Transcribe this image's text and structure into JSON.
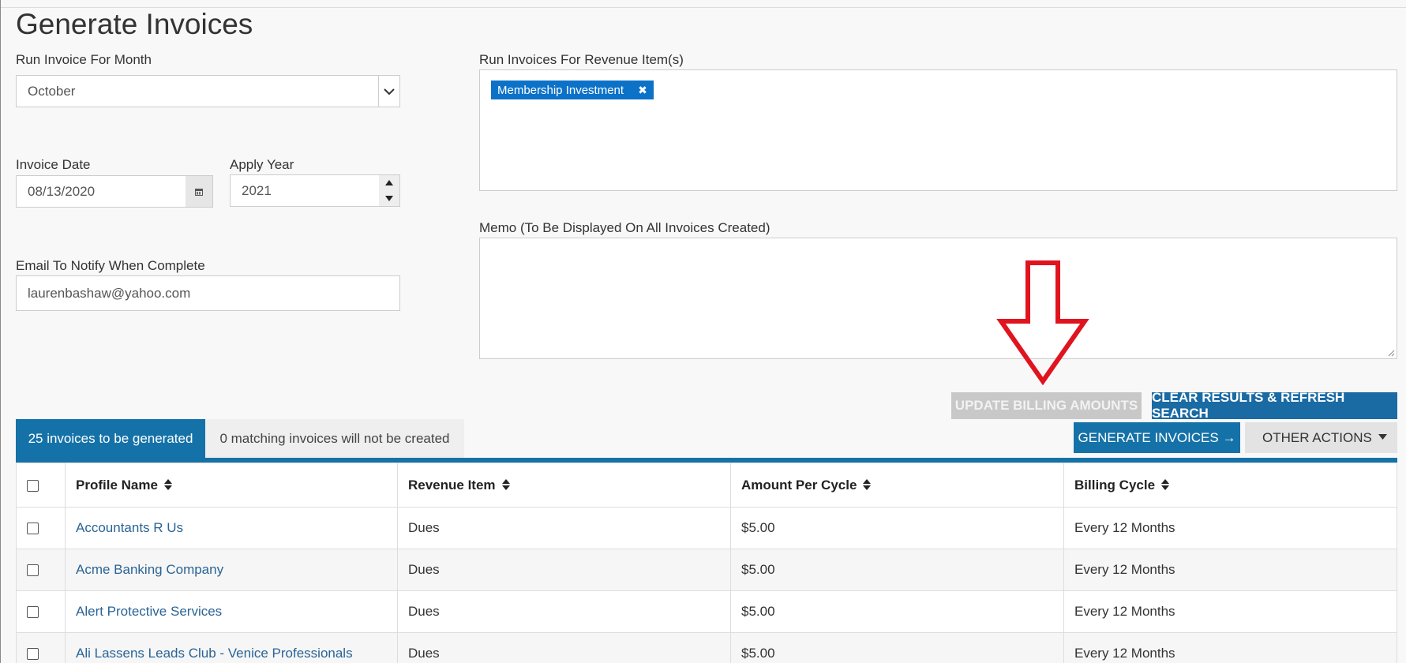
{
  "page": {
    "title": "Generate Invoices"
  },
  "form": {
    "month": {
      "label": "Run Invoice For Month",
      "value": "October"
    },
    "invoice_date": {
      "label": "Invoice Date",
      "value": "08/13/2020"
    },
    "apply_year": {
      "label": "Apply Year",
      "value": "2021"
    },
    "email": {
      "label": "Email To Notify When Complete",
      "value": "laurenbashaw@yahoo.com"
    },
    "revenue_items": {
      "label": "Run Invoices For Revenue Item(s)",
      "chips": [
        "Membership Investment"
      ],
      "chip_remove": "✖"
    },
    "memo": {
      "label": "Memo (To Be Displayed On All Invoices Created)",
      "value": ""
    }
  },
  "actions": {
    "update_billing": "UPDATE BILLING AMOUNTS",
    "clear_refresh": "CLEAR RESULTS & REFRESH SEARCH",
    "generate": "GENERATE INVOICES →",
    "other": "OTHER ACTIONS"
  },
  "tabs": [
    {
      "label": "25 invoices to be generated",
      "active": true
    },
    {
      "label": "0 matching invoices will not be created",
      "active": false
    }
  ],
  "table": {
    "columns": [
      "Profile Name",
      "Revenue Item",
      "Amount Per Cycle",
      "Billing Cycle"
    ],
    "rows": [
      {
        "profile": "Accountants R Us",
        "revenue": "Dues",
        "amount": "$5.00",
        "cycle": "Every 12 Months"
      },
      {
        "profile": "Acme Banking Company",
        "revenue": "Dues",
        "amount": "$5.00",
        "cycle": "Every 12 Months"
      },
      {
        "profile": "Alert Protective Services",
        "revenue": "Dues",
        "amount": "$5.00",
        "cycle": "Every 12 Months"
      },
      {
        "profile": "Ali Lassens Leads Club - Venice Professionals",
        "revenue": "Dues",
        "amount": "$5.00",
        "cycle": "Every 12 Months"
      }
    ]
  },
  "colors": {
    "primary": "#1572a8",
    "chip": "#0c72c8",
    "arrow": "#e0141e",
    "disabled": "#c8c8c8"
  },
  "icons": [
    "chevron-down-icon",
    "calendar-icon",
    "spinner-up-icon",
    "spinner-down-icon",
    "remove-icon",
    "sort-icon",
    "caret-down-icon",
    "arrow-down-annotation"
  ]
}
